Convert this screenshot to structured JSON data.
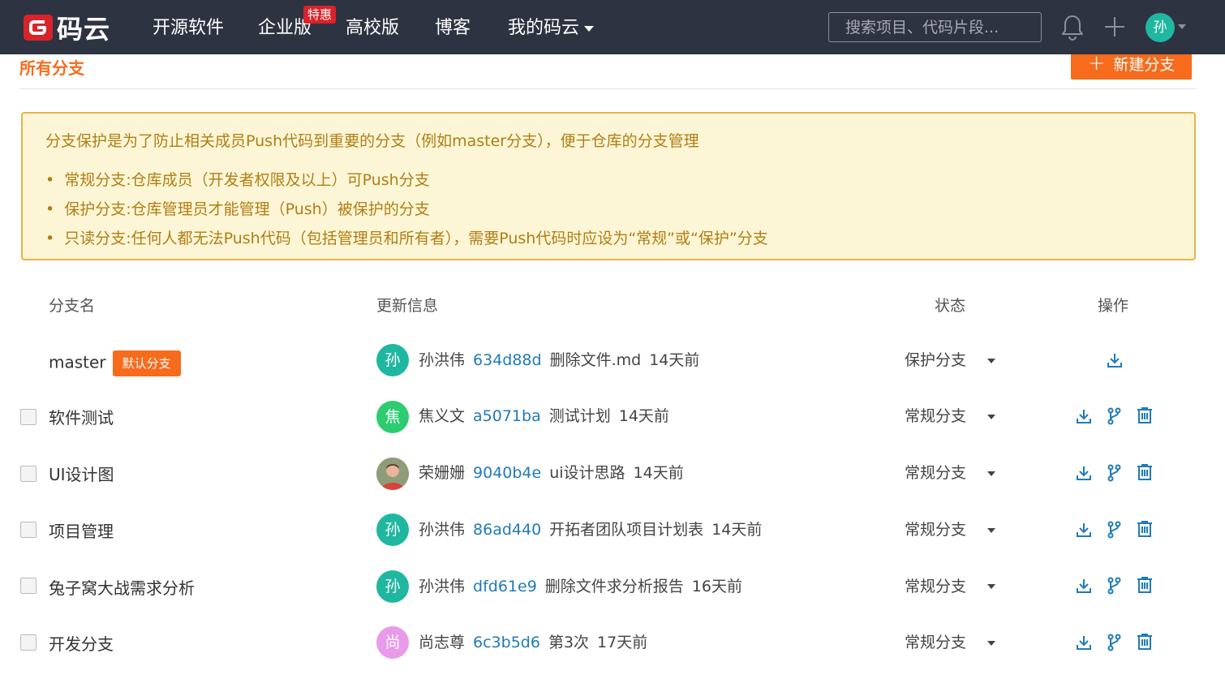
{
  "nav": {
    "logo_text": "码云",
    "items": [
      {
        "label": "开源软件"
      },
      {
        "label": "企业版"
      },
      {
        "label": "高校版"
      },
      {
        "label": "博客"
      },
      {
        "label": "我的码云"
      }
    ],
    "hot_badge": "特惠",
    "search_placeholder": "搜索项目、代码片段...",
    "user_avatar": "孙"
  },
  "section": {
    "title": "所有分支",
    "new_branch_label": "新建分支"
  },
  "notice": {
    "intro": "分支保护是为了防止相关成员Push代码到重要的分支（例如master分支），便于仓库的分支管理",
    "points": [
      "常规分支:仓库成员（开发者权限及以上）可Push分支",
      "保护分支:仓库管理员才能管理（Push）被保护的分支",
      "只读分支:任何人都无法Push代码（包括管理员和所有者），需要Push代码时应设为“常规”或“保护”分支"
    ]
  },
  "table": {
    "headers": {
      "name": "分支名",
      "info": "更新信息",
      "status": "状态",
      "actions": "操作"
    },
    "default_tag": "默认分支",
    "rows": [
      {
        "name": "master",
        "is_default": true,
        "avatar": "孙",
        "avatar_color": "#20b7a0",
        "author": "孙洪伟",
        "hash": "634d88d",
        "message": "删除文件.md",
        "time": "14天前",
        "status": "保护分支"
      },
      {
        "name": "软件测试",
        "is_default": false,
        "avatar": "焦",
        "avatar_color": "#2ecc71",
        "author": "焦义文",
        "hash": "a5071ba",
        "message": "测试计划",
        "time": "14天前",
        "status": "常规分支"
      },
      {
        "name": "UI设计图",
        "is_default": false,
        "avatar": "",
        "avatar_color": "#c9736a",
        "author": "荣姗姗",
        "hash": "9040b4e",
        "message": "ui设计思路",
        "time": "14天前",
        "status": "常规分支"
      },
      {
        "name": "项目管理",
        "is_default": false,
        "avatar": "孙",
        "avatar_color": "#20b7a0",
        "author": "孙洪伟",
        "hash": "86ad440",
        "message": "开拓者团队项目计划表",
        "time": "14天前",
        "status": "常规分支"
      },
      {
        "name": "兔子窝大战需求分析",
        "is_default": false,
        "avatar": "孙",
        "avatar_color": "#20b7a0",
        "author": "孙洪伟",
        "hash": "dfd61e9",
        "message": "删除文件求分析报告",
        "time": "16天前",
        "status": "常规分支"
      },
      {
        "name": "开发分支",
        "is_default": false,
        "avatar": "尚",
        "avatar_color": "#e79be8",
        "author": "尚志尊",
        "hash": "6c3b5d6",
        "message": "第3次",
        "time": "17天前",
        "status": "常规分支"
      }
    ]
  },
  "colors": {
    "nav_bg": "#2e3341",
    "accent": "#f76b1c",
    "link": "#1f7bb8",
    "notice_bg": "#fdf6d6",
    "notice_text": "#b07d14"
  }
}
